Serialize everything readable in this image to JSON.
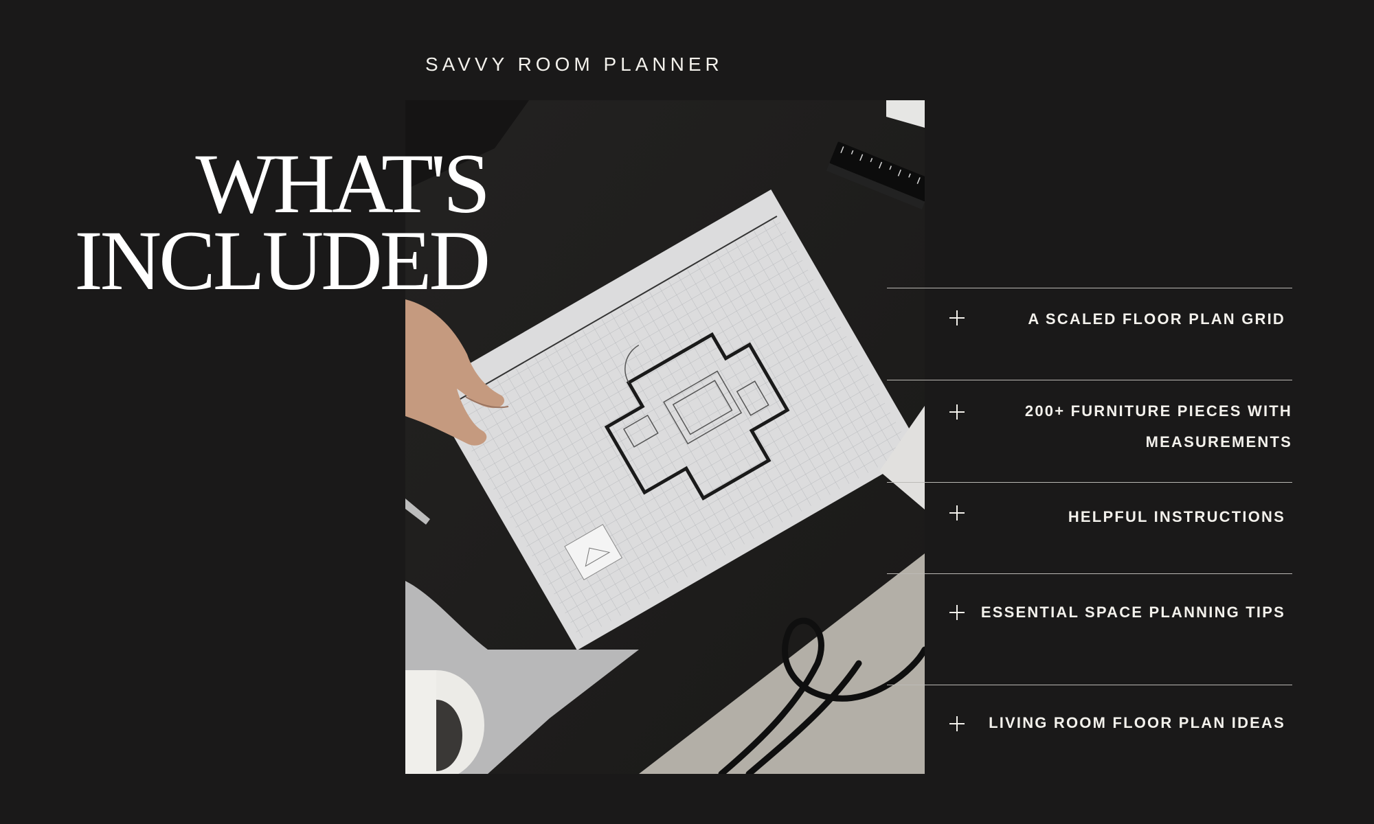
{
  "header": {
    "eyebrow": "SAVVY ROOM PLANNER"
  },
  "hero": {
    "headline_line1": "WHAT'S",
    "headline_line2": "INCLUDED",
    "image_description_icon": "floor-plan-photo"
  },
  "accordion": {
    "icon": "plus-icon",
    "items": [
      {
        "label": "A SCALED FLOOR PLAN GRID"
      },
      {
        "label": "200+ FURNITURE PIECES WITH MEASUREMENTS"
      },
      {
        "label": "HELPFUL INSTRUCTIONS"
      },
      {
        "label": "ESSENTIAL SPACE PLANNING TIPS"
      },
      {
        "label": "LIVING ROOM FLOOR PLAN IDEAS"
      }
    ]
  },
  "colors": {
    "background": "#1a1919",
    "text": "#f3f1ec",
    "divider": "#bcbab6"
  }
}
